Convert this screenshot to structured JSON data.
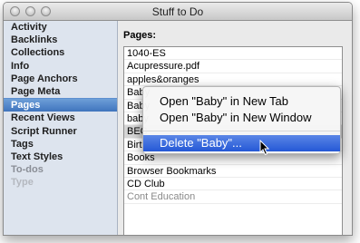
{
  "window": {
    "title": "Stuff to Do"
  },
  "sidebar": {
    "items": [
      {
        "label": "Activity",
        "state": "normal"
      },
      {
        "label": "Backlinks",
        "state": "normal"
      },
      {
        "label": "Collections",
        "state": "normal"
      },
      {
        "label": "Info",
        "state": "normal"
      },
      {
        "label": "Page Anchors",
        "state": "normal"
      },
      {
        "label": "Page Meta",
        "state": "normal"
      },
      {
        "label": "Pages",
        "state": "selected"
      },
      {
        "label": "Recent Views",
        "state": "normal"
      },
      {
        "label": "Script Runner",
        "state": "normal"
      },
      {
        "label": "Tags",
        "state": "normal"
      },
      {
        "label": "Text Styles",
        "state": "normal"
      },
      {
        "label": "To-dos",
        "state": "dim"
      },
      {
        "label": "Type",
        "state": "dim2"
      }
    ]
  },
  "pages": {
    "label": "Pages:",
    "rows": [
      {
        "label": "1040-ES",
        "state": "normal"
      },
      {
        "label": "Acupressure.pdf",
        "state": "normal"
      },
      {
        "label": "apples&oranges",
        "state": "normal"
      },
      {
        "label": "Baby",
        "state": "normal"
      },
      {
        "label": "Baby",
        "state": "normal"
      },
      {
        "label": "baby",
        "state": "normal"
      },
      {
        "label": "BEC",
        "state": "highlighted"
      },
      {
        "label": "Birth",
        "state": "normal"
      },
      {
        "label": "Books",
        "state": "normal"
      },
      {
        "label": "Browser Bookmarks",
        "state": "normal"
      },
      {
        "label": "CD Club",
        "state": "normal"
      },
      {
        "label": "Cont Education",
        "state": "dim"
      }
    ]
  },
  "context_menu": {
    "open_new_tab": "Open \"Baby\" in New Tab",
    "open_new_window": "Open \"Baby\" in New Window",
    "delete": "Delete \"Baby\"..."
  },
  "colors": {
    "selection_blue": "#3f74bd",
    "menu_highlight": "#2458d6",
    "sidebar_bg": "#dde4ee"
  }
}
